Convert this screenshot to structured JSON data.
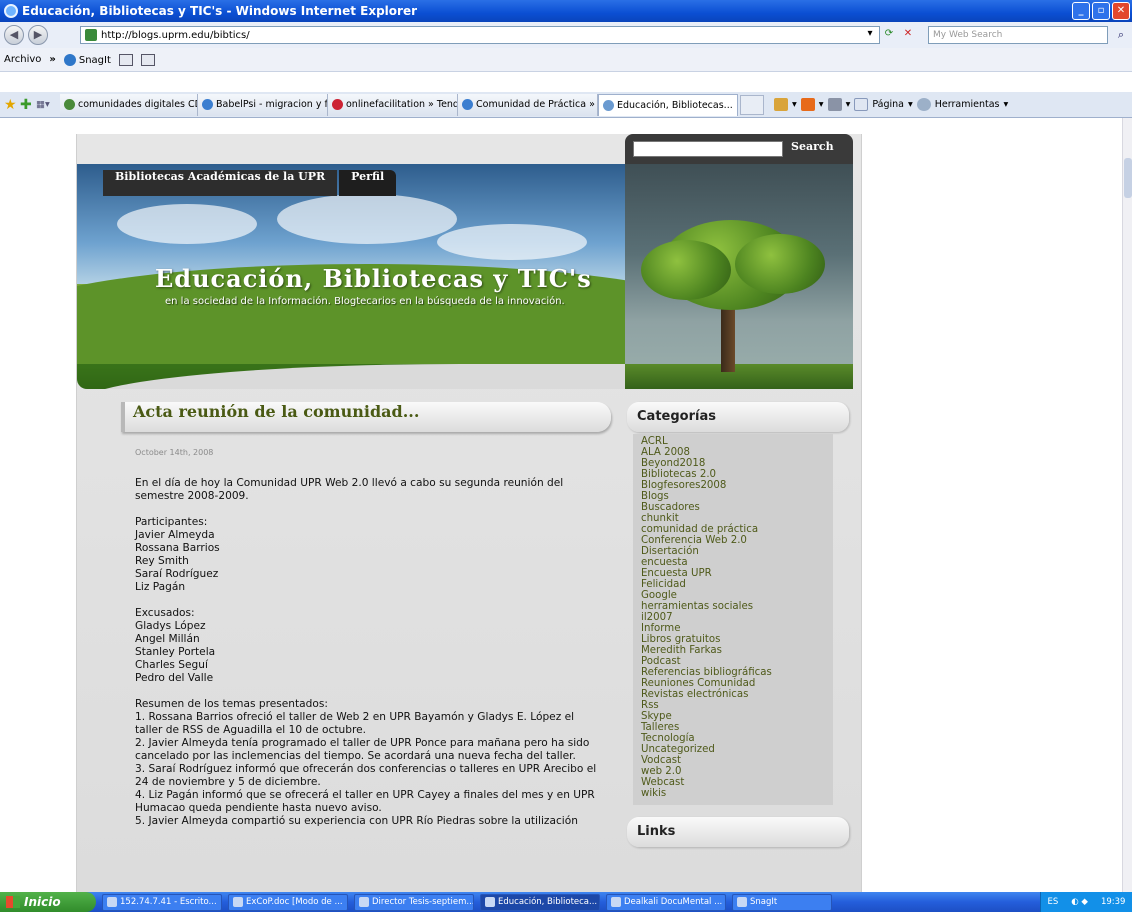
{
  "window": {
    "title": "Educación, Bibliotecas y TIC's - Windows Internet Explorer"
  },
  "addressbar": {
    "url": "http://blogs.uprm.edu/bibtics/",
    "search_placeholder": "My Web Search"
  },
  "menubar": {
    "archivo": "Archivo",
    "chevron": "»",
    "snagit": "SnagIt"
  },
  "tabs": [
    {
      "label": "comunidades digitales CDI..."
    },
    {
      "label": "BabelPsi - migracion y fen..."
    },
    {
      "label": "onlinefacilitation » Tendril..."
    },
    {
      "label": "Comunidad de Práctica » ..."
    },
    {
      "label": "Educación, Bibliotecas..."
    }
  ],
  "commandbar": {
    "pagina": "Página",
    "herramientas": "Herramientas"
  },
  "site": {
    "search_button": "Search",
    "nav": [
      "Bibliotecas Académicas de la UPR",
      "Perfil"
    ],
    "title": "Educación, Bibliotecas y TIC's",
    "tagline": "en la sociedad de la Información. Blogtecarios en la búsqueda de la innovación."
  },
  "post": {
    "title": "Acta reunión de la comunidad...",
    "date": "October 14th, 2008",
    "paragraphs": [
      "En el día de hoy la Comunidad UPR Web 2.0 llevó a cabo su segunda reunión del semestre 2008-2009.",
      "Participantes:\nJavier Almeyda\nRossana Barrios\nRey Smith\nSaraí Rodríguez\nLiz Pagán",
      "Excusados:\nGladys López\nAngel Millán\nStanley Portela\nCharles Seguí\nPedro del Valle",
      "Resumen de los temas presentados:\n1. Rossana Barrios ofreció el taller de Web 2 en UPR Bayamón y Gladys E. López el taller de RSS de Aguadilla el 10 de octubre.\n2. Javier Almeyda tenía programado el taller de UPR Ponce para mañana pero ha sido cancelado por las inclemencias del tiempo. Se acordará una nueva fecha del taller.\n3. Saraí Rodríguez informó que ofrecerán dos conferencias o talleres en UPR Arecibo el 24 de noviembre y 5 de diciembre.\n4. Liz Pagán informó que se ofrecerá el taller en UPR Cayey a finales del mes y en UPR Humacao queda pendiente hasta nuevo aviso.\n5. Javier Almeyda compartió su experiencia con UPR Río Piedras sobre la utilización"
    ]
  },
  "sidebar": {
    "categories_title": "Categorías",
    "categories": [
      "ACRL",
      "ALA 2008",
      "Beyond2018",
      "Bibliotecas 2.0",
      "Blogfesores2008",
      "Blogs",
      "Buscadores",
      "chunkit",
      "comunidad de práctica",
      "Conferencia Web 2.0",
      "Disertación",
      "encuesta",
      "Encuesta UPR",
      "Felicidad",
      "Google",
      "herramientas sociales",
      "il2007",
      "Informe",
      "Libros gratuitos",
      "Meredith Farkas",
      "Podcast",
      "Referencias bibliográficas",
      "Reuniones Comunidad",
      "Revistas electrónicas",
      "Rss",
      "Skype",
      "Talleres",
      "Tecnología",
      "Uncategorized",
      "Vodcast",
      "web 2.0",
      "Webcast",
      "wikis"
    ],
    "links_title": "Links"
  },
  "taskbar": {
    "start": "Inicio",
    "tasks": [
      {
        "label": "152.74.7.41 - Escrito..."
      },
      {
        "label": "ExCoP.doc [Modo de ..."
      },
      {
        "label": "Director Tesis-septiem..."
      },
      {
        "label": "Educación, Biblioteca..."
      },
      {
        "label": "Dealkali DocuMental ..."
      },
      {
        "label": "SnagIt"
      }
    ],
    "lang": "ES",
    "time": "19:39"
  }
}
